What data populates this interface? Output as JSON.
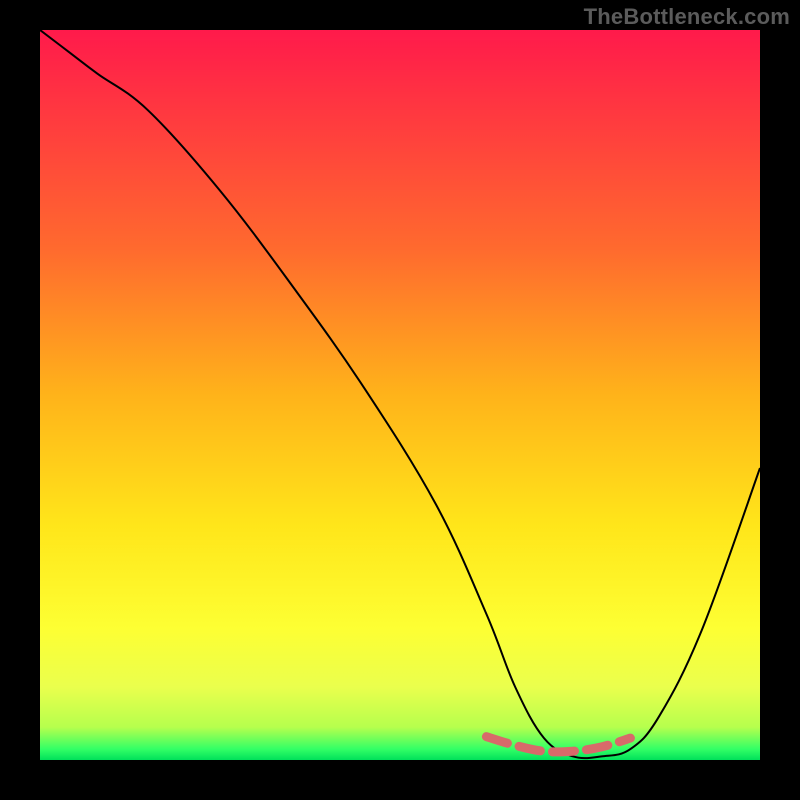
{
  "watermark": "TheBottleneck.com",
  "gradient": {
    "stops": [
      {
        "offset": 0.0,
        "color": "#ff1a4b"
      },
      {
        "offset": 0.12,
        "color": "#ff3a3f"
      },
      {
        "offset": 0.3,
        "color": "#ff6a2e"
      },
      {
        "offset": 0.5,
        "color": "#ffb31a"
      },
      {
        "offset": 0.68,
        "color": "#ffe61a"
      },
      {
        "offset": 0.82,
        "color": "#fdff33"
      },
      {
        "offset": 0.9,
        "color": "#eaff4d"
      },
      {
        "offset": 0.955,
        "color": "#b6ff4d"
      },
      {
        "offset": 0.985,
        "color": "#33ff66"
      },
      {
        "offset": 1.0,
        "color": "#00e05a"
      }
    ]
  },
  "bottom_marker": {
    "color": "#d86a6a",
    "width": 9,
    "dash": "22 12"
  },
  "chart_data": {
    "type": "line",
    "title": "",
    "xlabel": "",
    "ylabel": "",
    "xlim": [
      0,
      100
    ],
    "ylim": [
      0,
      100
    ],
    "series": [
      {
        "name": "bottleneck-curve",
        "x": [
          0,
          4,
          8,
          15,
          25,
          35,
          45,
          55,
          62,
          66,
          70,
          74,
          78,
          82,
          86,
          92,
          100
        ],
        "y": [
          100,
          97,
          94,
          89,
          78,
          65,
          51,
          35,
          20,
          10,
          3,
          0.5,
          0.5,
          1.5,
          6,
          18,
          40
        ]
      },
      {
        "name": "optimal-range-marker",
        "x": [
          62,
          66,
          70,
          74,
          78,
          82
        ],
        "y": [
          3.2,
          2.0,
          1.2,
          1.2,
          1.8,
          3.0
        ]
      }
    ]
  }
}
